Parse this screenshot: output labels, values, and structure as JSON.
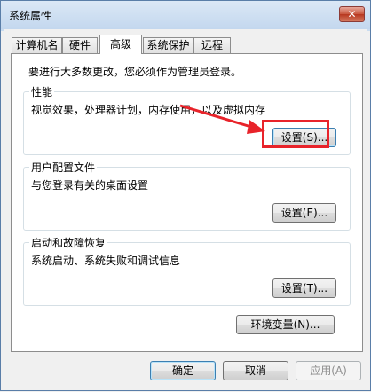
{
  "window": {
    "title": "系统属性",
    "close_glyph": "✕"
  },
  "tabs": [
    {
      "label": "计算机名",
      "active": false
    },
    {
      "label": "硬件",
      "active": false
    },
    {
      "label": "高级",
      "active": true
    },
    {
      "label": "系统保护",
      "active": false
    },
    {
      "label": "远程",
      "active": false
    }
  ],
  "advanced": {
    "admin_notice": "要进行大多数更改，您必须作为管理员登录。",
    "performance": {
      "title": "性能",
      "description": "视觉效果，处理器计划，内存使用，以及虚拟内存",
      "settings_button": "设置(S)..."
    },
    "user_profiles": {
      "title": "用户配置文件",
      "description": "与您登录有关的桌面设置",
      "settings_button": "设置(E)..."
    },
    "startup_recovery": {
      "title": "启动和故障恢复",
      "description": "系统启动、系统失败和调试信息",
      "settings_button": "设置(T)..."
    },
    "env_vars_button": "环境变量(N)..."
  },
  "dialog_buttons": {
    "ok": "确定",
    "cancel": "取消",
    "apply": "应用(A)"
  },
  "annotation": {
    "color": "#e8232a",
    "target": "性能 设置(S)..."
  }
}
